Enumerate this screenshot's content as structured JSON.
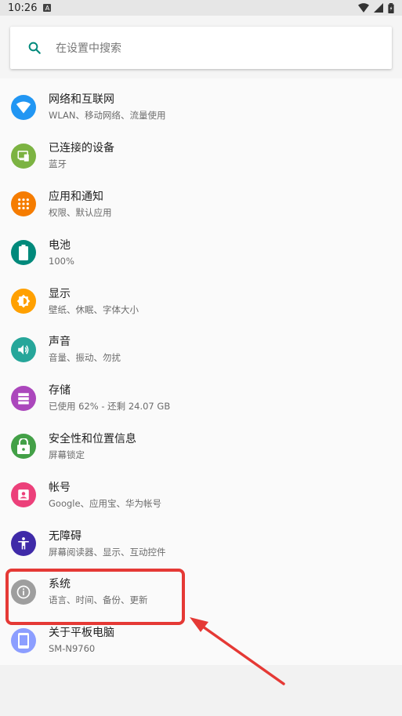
{
  "status_bar": {
    "time": "10:26",
    "notif_badge": "A"
  },
  "search": {
    "placeholder": "在设置中搜索"
  },
  "items": [
    {
      "key": "network",
      "title": "网络和互联网",
      "subtitle": "WLAN、移动网络、流量使用",
      "color": "#2196F3",
      "icon": "wifi-icon"
    },
    {
      "key": "connected",
      "title": "已连接的设备",
      "subtitle": "蓝牙",
      "color": "#7CB342",
      "icon": "devices-icon"
    },
    {
      "key": "apps",
      "title": "应用和通知",
      "subtitle": "权限、默认应用",
      "color": "#F57C00",
      "icon": "apps-grid-icon"
    },
    {
      "key": "battery",
      "title": "电池",
      "subtitle": "100%",
      "color": "#00897B",
      "icon": "battery-icon"
    },
    {
      "key": "display",
      "title": "显示",
      "subtitle": "壁纸、休眠、字体大小",
      "color": "#FFA000",
      "icon": "brightness-icon"
    },
    {
      "key": "sound",
      "title": "声音",
      "subtitle": "音量、振动、勿扰",
      "color": "#26A69A",
      "icon": "volume-icon"
    },
    {
      "key": "storage",
      "title": "存储",
      "subtitle": "已使用 62% - 还剩 24.07 GB",
      "color": "#AB47BC",
      "icon": "storage-icon"
    },
    {
      "key": "security",
      "title": "安全性和位置信息",
      "subtitle": "屏幕锁定",
      "color": "#43A047",
      "icon": "lock-icon"
    },
    {
      "key": "accounts",
      "title": "帐号",
      "subtitle": "Google、应用宝、华为帐号",
      "color": "#EC407A",
      "icon": "account-icon"
    },
    {
      "key": "accessibility",
      "title": "无障碍",
      "subtitle": "屏幕阅读器、显示、互动控件",
      "color": "#3F2AA8",
      "icon": "accessibility-icon"
    },
    {
      "key": "system",
      "title": "系统",
      "subtitle": "语言、时间、备份、更新",
      "color": "#9E9E9E",
      "icon": "info-icon"
    },
    {
      "key": "about",
      "title": "关于平板电脑",
      "subtitle": "SM-N9760",
      "color": "#8C9EFF",
      "icon": "tablet-icon"
    }
  ],
  "colors": {
    "accent": "#00897B",
    "annotation": "#E53935"
  }
}
